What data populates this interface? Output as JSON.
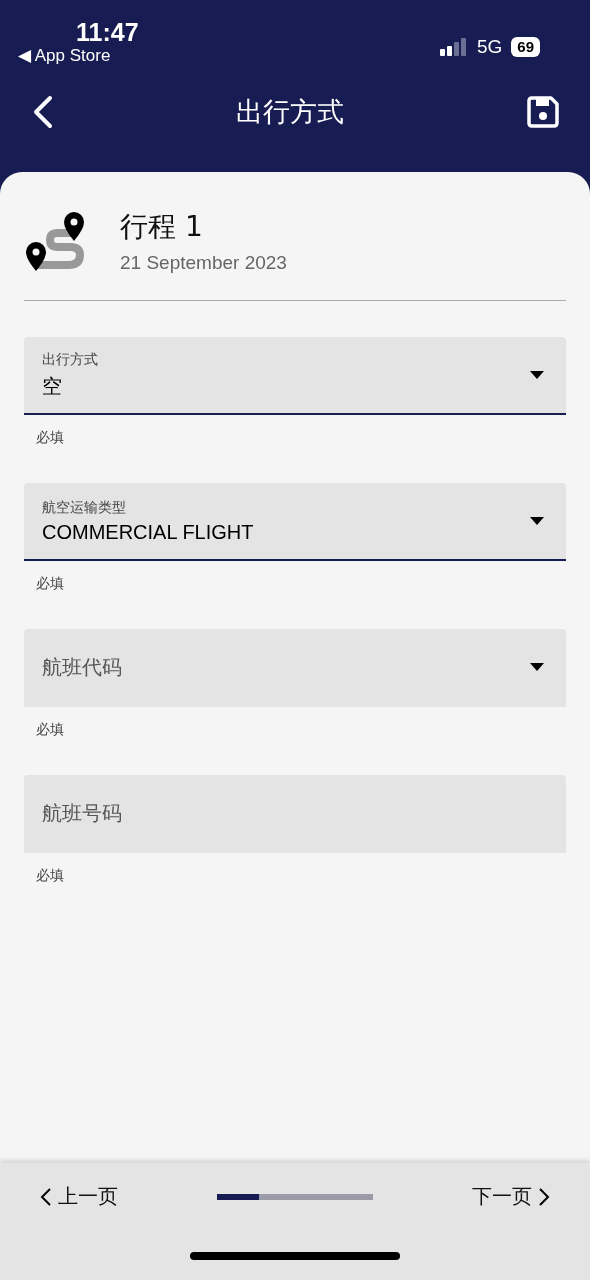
{
  "status_bar": {
    "time": "11:47",
    "back_app": "◀ App Store",
    "network": "5G",
    "battery": "69"
  },
  "nav": {
    "title": "出行方式"
  },
  "trip": {
    "title": "行程 1",
    "date": "21 September 2023"
  },
  "fields": [
    {
      "kind": "select",
      "label": "出行方式",
      "value": "空",
      "hint": "必填"
    },
    {
      "kind": "select",
      "label": "航空运输类型",
      "value": "COMMERCIAL FLIGHT",
      "hint": "必填"
    },
    {
      "kind": "select",
      "placeholder": "航班代码",
      "hint": "必填"
    },
    {
      "kind": "text",
      "placeholder": "航班号码",
      "hint": "必填"
    }
  ],
  "footer": {
    "prev": "上一页",
    "next": "下一页",
    "progress": {
      "level": 0.27
    }
  }
}
